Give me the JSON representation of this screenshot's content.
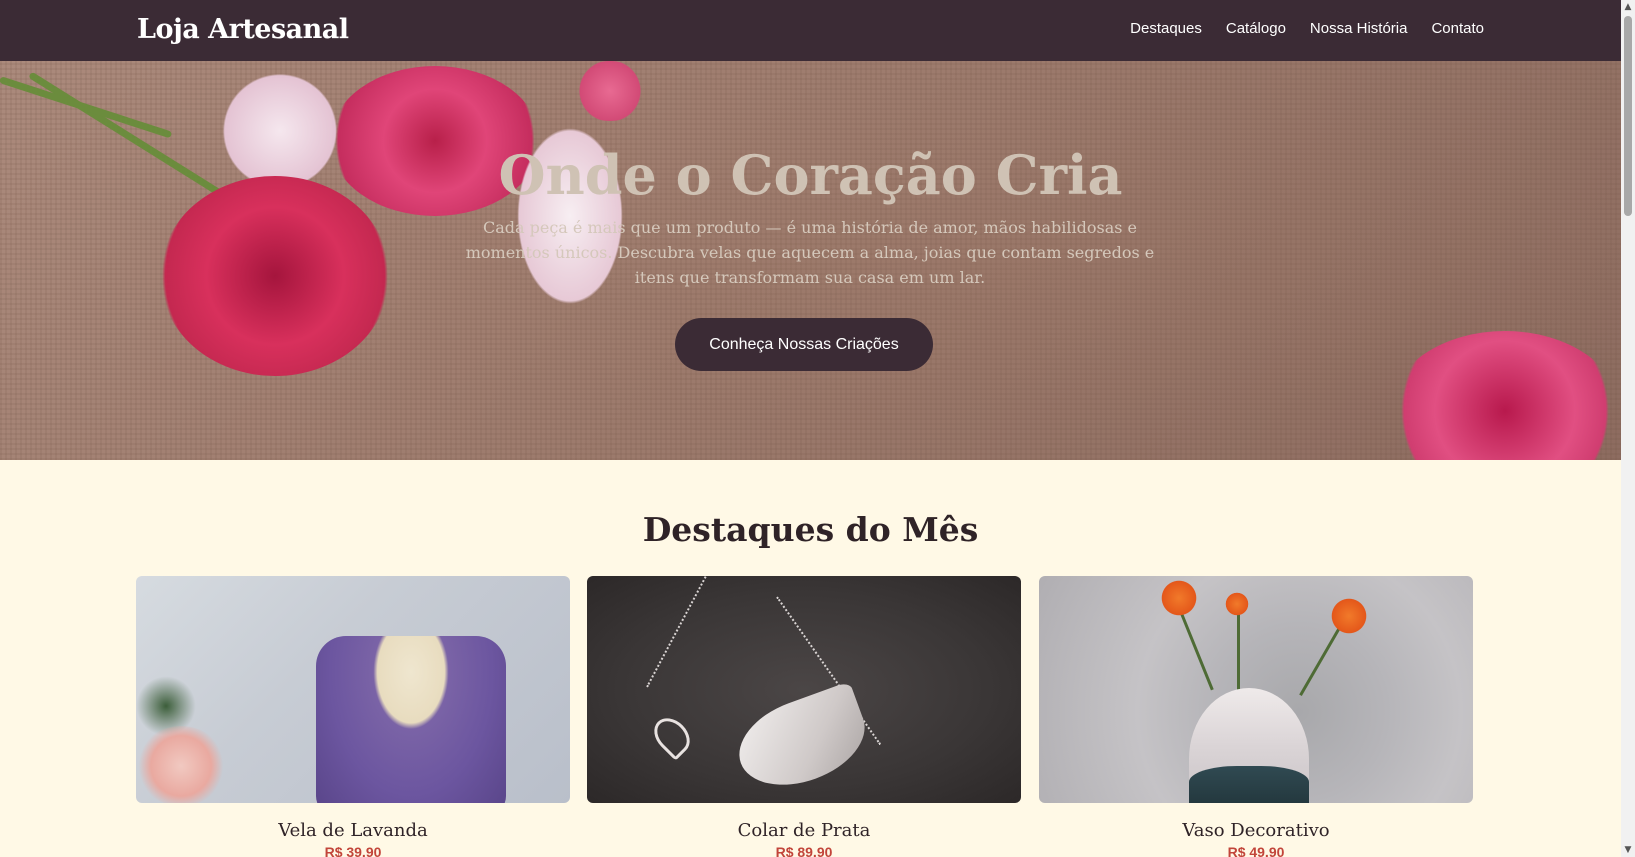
{
  "header": {
    "logo": "Loja Artesanal",
    "nav": [
      "Destaques",
      "Catálogo",
      "Nossa História",
      "Contato"
    ]
  },
  "hero": {
    "title": "Onde o Coração Cria",
    "subtitle": "Cada peça é mais que um produto — é uma história de amor, mãos habilidosas e momentos únicos. Descubra velas que aquecem a alma, joias que contam segredos e itens que transformam sua casa em um lar.",
    "cta_label": "Conheça Nossas Criações"
  },
  "highlights": {
    "title": "Destaques do Mês",
    "products": [
      {
        "name": "Vela de Lavanda",
        "price": "R$ 39,90",
        "image": "lavender-candle"
      },
      {
        "name": "Colar de Prata",
        "price": "R$ 89,90",
        "image": "silver-necklace"
      },
      {
        "name": "Vaso Decorativo",
        "price": "R$ 49,90",
        "image": "decorative-vase"
      }
    ]
  },
  "colors": {
    "header_bg": "#3b2b35",
    "page_bg": "#fff9e6",
    "price": "#c2453a",
    "button_bg": "#3b2b35"
  }
}
